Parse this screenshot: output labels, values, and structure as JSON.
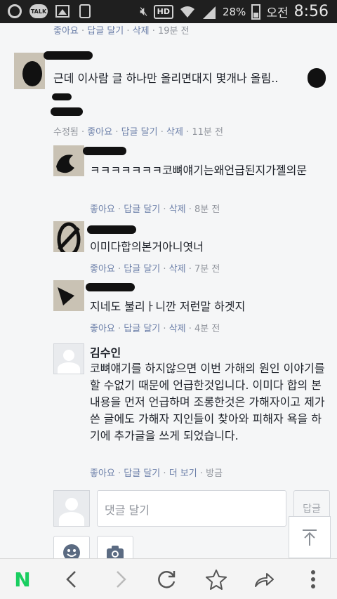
{
  "status_bar": {
    "talk_label": "TALK",
    "hd_label": "HD",
    "battery": "28%",
    "ampm": "오전",
    "time": "8:56"
  },
  "comments": [
    {
      "meta": {
        "like": "좋아요",
        "reply": "답글 달기",
        "delete": "삭제",
        "time": "19분 전"
      }
    },
    {
      "text": "근데 이사람 글 하나만 올리면대지 몇개나 올림..",
      "meta": {
        "edited": "수정됨",
        "like": "좋아요",
        "reply": "답글 달기",
        "delete": "삭제",
        "time": "11분 전"
      }
    },
    {
      "text": "ㅋㅋㅋㅋㅋㅋㅋ코뼈얘기는왜언급된지가젤의문",
      "meta": {
        "like": "좋아요",
        "reply": "답글 달기",
        "delete": "삭제",
        "time": "8분 전"
      }
    },
    {
      "text": "이미다합의본거아니엿너",
      "meta": {
        "like": "좋아요",
        "reply": "답글 달기",
        "delete": "삭제",
        "time": "7분 전"
      }
    },
    {
      "text": "지네도 불리ㅏ니깐 저런말 하겟지",
      "meta": {
        "like": "좋아요",
        "reply": "답글 달기",
        "delete": "삭제",
        "time": "4분 전"
      }
    },
    {
      "name": "김수인",
      "text": "코뼈얘기를 하지않으면 이번 가해의 원인 이야기를 할 수없기 때문에 언급한것입니다. 이미다 합의 본내용을 먼저 언급하며 조롱한것은 가해자이고 제가 쓴 글에도 가해자 지인들이 찾아와 피해자 욕을 하기에 추가글을 쓰게 되었습니다.",
      "meta": {
        "like": "좋아요",
        "reply": "답글 달기",
        "more": "더 보기",
        "time": "방금"
      }
    }
  ],
  "reply_box": {
    "placeholder": "댓글 달기",
    "submit_label": "답글"
  },
  "nav": {
    "home_label": "N"
  },
  "colors": {
    "naver_green": "#19ce60",
    "link": "#6a7ea8",
    "meta": "#90949c"
  }
}
